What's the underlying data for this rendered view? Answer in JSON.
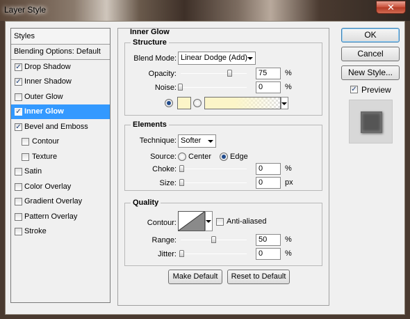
{
  "window": {
    "title": "Layer Style",
    "close_glyph": "✕"
  },
  "styles_panel": {
    "header": "Styles",
    "blending_options": "Blending Options: Default",
    "items": [
      {
        "label": "Drop Shadow",
        "checked": true,
        "sub": false,
        "selected": false
      },
      {
        "label": "Inner Shadow",
        "checked": true,
        "sub": false,
        "selected": false
      },
      {
        "label": "Outer Glow",
        "checked": false,
        "sub": false,
        "selected": false
      },
      {
        "label": "Inner Glow",
        "checked": true,
        "sub": false,
        "selected": true
      },
      {
        "label": "Bevel and Emboss",
        "checked": true,
        "sub": false,
        "selected": false
      },
      {
        "label": "Contour",
        "checked": false,
        "sub": true,
        "selected": false
      },
      {
        "label": "Texture",
        "checked": false,
        "sub": true,
        "selected": false
      },
      {
        "label": "Satin",
        "checked": false,
        "sub": false,
        "selected": false
      },
      {
        "label": "Color Overlay",
        "checked": false,
        "sub": false,
        "selected": false
      },
      {
        "label": "Gradient Overlay",
        "checked": false,
        "sub": false,
        "selected": false
      },
      {
        "label": "Pattern Overlay",
        "checked": false,
        "sub": false,
        "selected": false
      },
      {
        "label": "Stroke",
        "checked": false,
        "sub": false,
        "selected": false
      }
    ]
  },
  "panel": {
    "title": "Inner Glow",
    "structure": {
      "title": "Structure",
      "blend_mode_label": "Blend Mode:",
      "blend_mode_value": "Linear Dodge (Add)",
      "opacity_label": "Opacity:",
      "opacity_value": "75",
      "opacity_level": 0.75,
      "noise_label": "Noise:",
      "noise_value": "0",
      "noise_level": 0,
      "percent": "%",
      "glow_color": "#fcf5c8"
    },
    "elements": {
      "title": "Elements",
      "technique_label": "Technique:",
      "technique_value": "Softer",
      "source_label": "Source:",
      "source_center": "Center",
      "source_edge": "Edge",
      "choke_label": "Choke:",
      "choke_value": "0",
      "size_label": "Size:",
      "size_value": "0",
      "percent": "%",
      "px": "px"
    },
    "quality": {
      "title": "Quality",
      "contour_label": "Contour:",
      "anti_aliased_label": "Anti-aliased",
      "anti_aliased_checked": false,
      "range_label": "Range:",
      "range_value": "50",
      "range_level": 0.5,
      "jitter_label": "Jitter:",
      "jitter_value": "0",
      "percent": "%"
    },
    "make_default": "Make Default",
    "reset_default": "Reset to Default"
  },
  "actions": {
    "ok": "OK",
    "cancel": "Cancel",
    "new_style": "New Style...",
    "preview_label": "Preview",
    "preview_checked": true
  },
  "colors": {
    "selected_row": "#3399ff",
    "dialog_bg": "#f0f0f0",
    "preview_swatch": "#555555"
  }
}
